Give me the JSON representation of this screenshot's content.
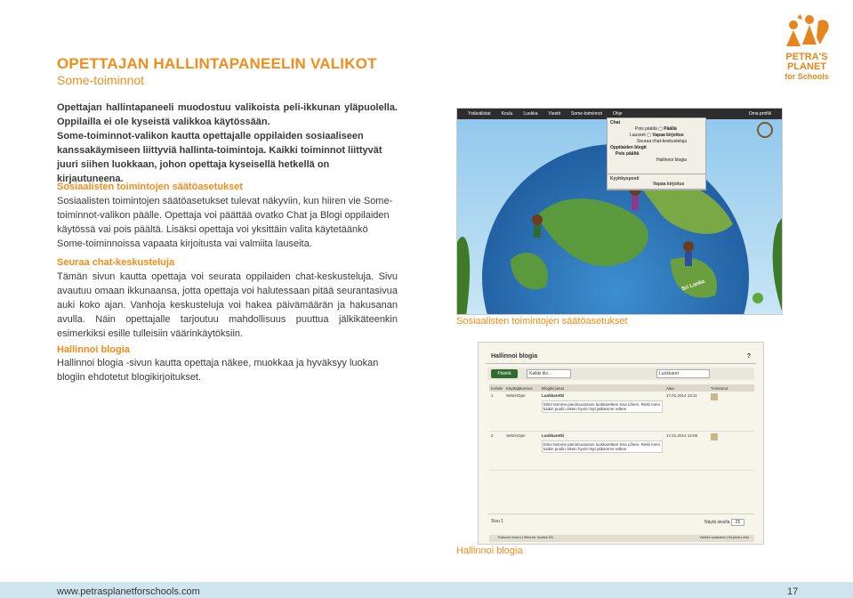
{
  "header": {
    "title": "OPETTAJAN HALLINTAPANEELIN VALIKOT",
    "subtitle": "Some-toiminnot"
  },
  "logo": {
    "line1": "PETRA'S",
    "line2": "PLANET",
    "line3": "for Schools"
  },
  "intro": {
    "p1": "Opettajan hallintapaneeli muodostuu valikoista peli-ikkunan yläpuolella. Oppilailla ei ole kyseistä valikkoa käytössään.",
    "p2": "Some-toiminnot-valikon kautta opettajalle oppilaiden sosiaaliseen kanssakäymiseen liittyviä hallinta-toimintoja. Kaikki toiminnot liittyvät juuri siihen luokkaan, johon opettaja kyseisellä hetkellä on kirjautuneena."
  },
  "section1": {
    "heading": "Sosiaalisten toimintojen säätöasetukset",
    "text": "Sosiaalisten toimintojen säätöasetukset tulevat näkyviin, kun hiiren vie Some-toiminnot-valikon päälle. Opettaja voi päättää ovatko Chat ja Blogi oppilaiden käytössä vai pois päältä. Lisäksi opettaja voi yksittäin valita käytetäänkö Some-toiminnoissa vapaata kirjoitusta vai valmiita lauseita."
  },
  "section2": {
    "heading": "Seuraa chat-keskusteluja",
    "text": "Tämän sivun kautta opettaja voi seurata oppilaiden chat-keskusteluja. Sivu avautuu omaan ikkunaansa, jotta opettaja voi halutessaan pitää seurantasivua auki koko ajan. Vanhoja keskusteluja voi hakea päivämäärän ja hakusanan avulla. Näin opettajalle tarjoutuu mahdollisuus puuttua jälkikäteenkin esimerkiksi esille tulleisiin väärinkäytöksiin."
  },
  "section3": {
    "heading": "Hallinnoi blogia",
    "text": "Hallinnoi blogia -sivun kautta opettaja näkee, muokkaa ja hyväksyy luokan blogiin ehdotetut blogikirjoitukset."
  },
  "screenshot1": {
    "caption": "Sosiaalisten toimintojen säätöasetukset",
    "menu": [
      "Ystävälistat",
      "Koulu",
      "Luokka",
      "Viestit",
      "Some-toiminnot",
      "Ohje"
    ],
    "profile": "Oma profiili",
    "dropdown": {
      "chat": "Chat",
      "pois": "Pois päältä",
      "paalla": "Päällä",
      "lauseet": "Lauseet",
      "vapaa": "Vapaa kirjoitus",
      "seuraa": "Seuraa chat-keskusteluja",
      "blogit": "Oppilaiden blogit",
      "hallinnoi": "Hallinnoi blogia",
      "kyhy": "Kyyhkysposti",
      "vapaa2": "Vapaa kirjoitus"
    },
    "labels": [
      "Sri Lanka"
    ]
  },
  "screenshot2": {
    "caption": "Hallinnoi blogia",
    "title": "Hallinnoi blogia",
    "help": "?",
    "button": "Päivitä",
    "filter": "Kaikki tilo...",
    "search": "Luokkaret",
    "columns": [
      "Kohde",
      "Käyttäjätunnus",
      "Blogikirjoitus",
      "Aika",
      "Toiminnot"
    ],
    "rows": [
      {
        "id": "1",
        "user": "SebrinOpe",
        "title": "Luokkaretki",
        "text": "Eilen teimme pienimuotoisen luokkaretken Sea Lifeen. Retki meni kaikin puolin oikein hyvin! Nyt jatkamme retken",
        "time": "17.01.2014 13:11"
      },
      {
        "id": "2",
        "user": "SebrinOpe",
        "title": "Luokkaretki",
        "text": "Eilen teimme pienimuotoisen luokkaretken Sea Lifeen. Retki meni kaikin puolin oikein hyvin! Nyt jatkamme retken",
        "time": "17.01.2014 13:09"
      }
    ],
    "page": "Sivu 1",
    "show": "Näytä sivulla",
    "show_value": "25",
    "footer_left": "Educom kouru | lifeurse, luokka ZA",
    "footer_right": "Vaihda salasana | Kirjaudu ulos"
  },
  "footer": {
    "url": "www.petrasplanetforschools.com",
    "page": "17"
  }
}
